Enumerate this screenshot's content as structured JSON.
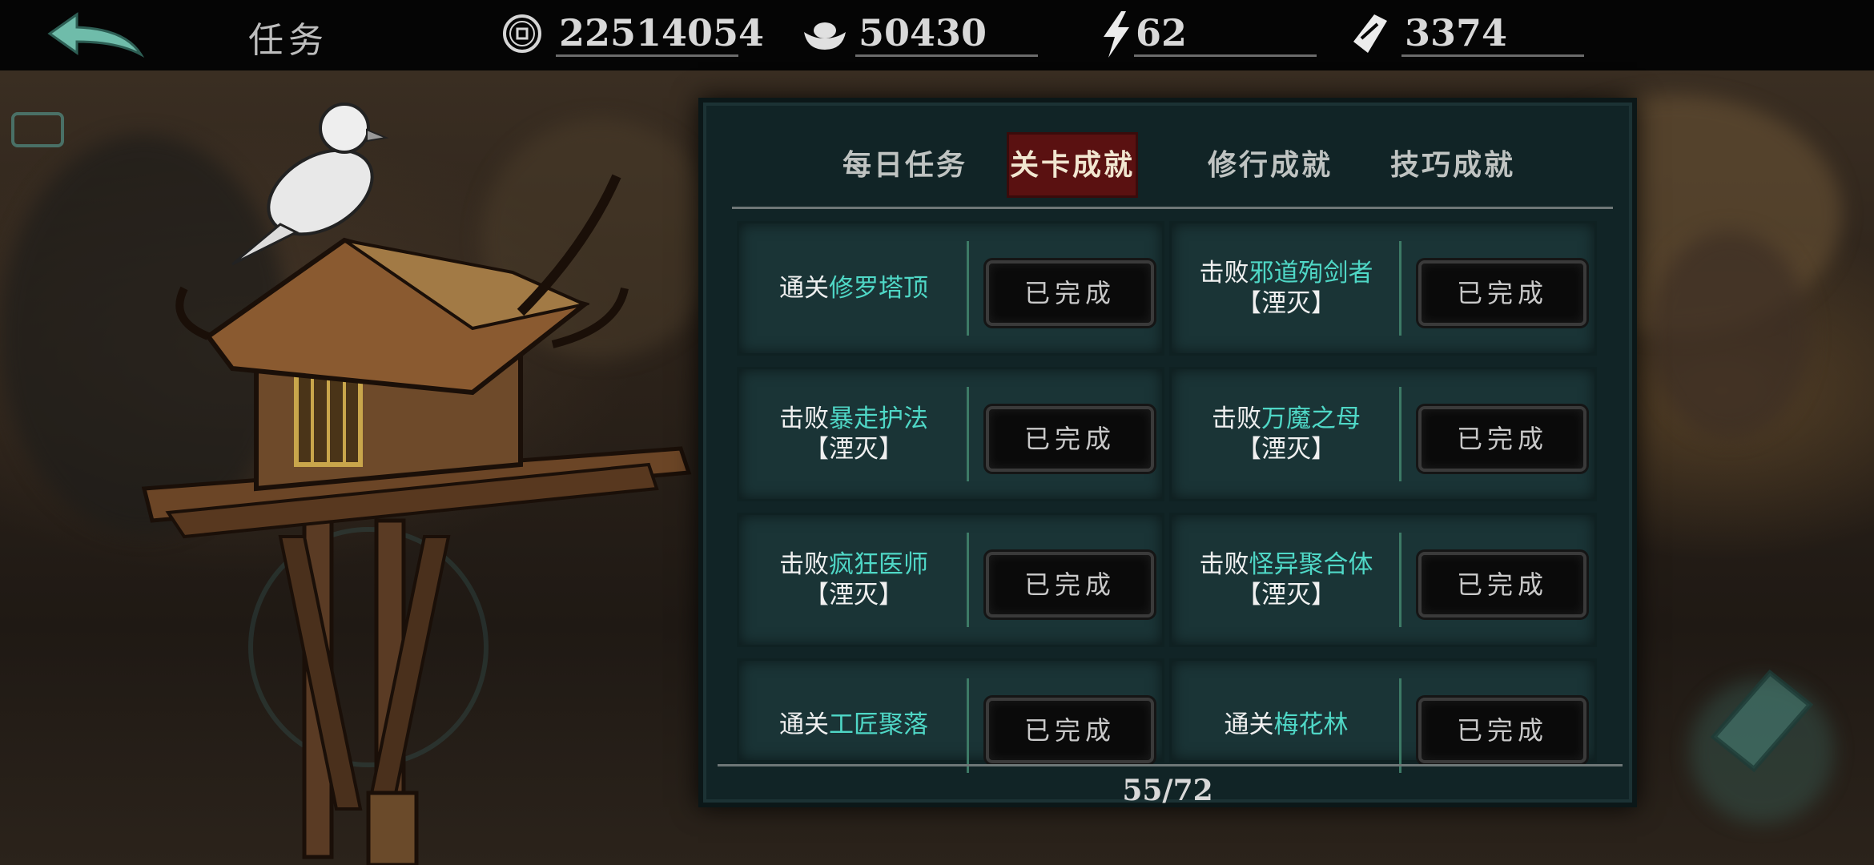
{
  "header": {
    "title": "任务",
    "back_icon": "back-arrow-icon"
  },
  "resources": [
    {
      "icon": "coin-icon",
      "value": "22514054"
    },
    {
      "icon": "ingot-icon",
      "value": "50430"
    },
    {
      "icon": "lightning-icon",
      "value": "62"
    },
    {
      "icon": "ticket-icon",
      "value": "3374"
    }
  ],
  "tabs": [
    {
      "label": "每日任务",
      "active": false
    },
    {
      "label": "关卡成就",
      "active": true
    },
    {
      "label": "修行成就",
      "active": false
    },
    {
      "label": "技巧成就",
      "active": false
    }
  ],
  "tasks": [
    {
      "prefix": "通关",
      "target": "修罗塔顶",
      "suffix": "",
      "status": "已完成"
    },
    {
      "prefix": "击败",
      "target": "邪道殉剑者",
      "suffix": "【湮灭】",
      "status": "已完成"
    },
    {
      "prefix": "击败",
      "target": "暴走护法",
      "suffix": "【湮灭】",
      "status": "已完成"
    },
    {
      "prefix": "击败",
      "target": "万魔之母",
      "suffix": "【湮灭】",
      "status": "已完成"
    },
    {
      "prefix": "击败",
      "target": "疯狂医师",
      "suffix": "【湮灭】",
      "status": "已完成"
    },
    {
      "prefix": "击败",
      "target": "怪异聚合体",
      "suffix": "【湮灭】",
      "status": "已完成"
    },
    {
      "prefix": "通关",
      "target": "工匠聚落",
      "suffix": "",
      "status": "已完成"
    },
    {
      "prefix": "通关",
      "target": "梅花林",
      "suffix": "",
      "status": "已完成"
    }
  ],
  "progress": "55/72",
  "colors": {
    "highlight": "#4fd7c6",
    "active_tab": "#5a1111",
    "panel_bg": "#112426"
  }
}
